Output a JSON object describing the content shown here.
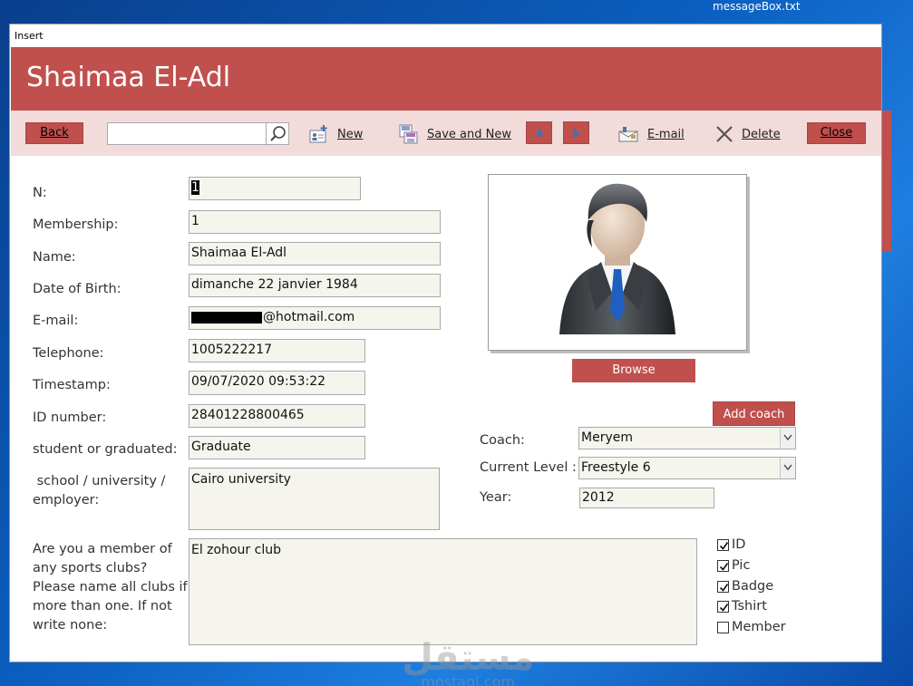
{
  "desktop": {
    "file_name": "messageBox.txt"
  },
  "window": {
    "title": "Insert"
  },
  "header": {
    "title": "Shaimaa El-Adl"
  },
  "toolbar": {
    "back_label": "Back",
    "search_value": "",
    "new_label": "New",
    "save_new_label": "Save and New",
    "email_label": "E-mail",
    "delete_label": "Delete",
    "close_label": "Close"
  },
  "form": {
    "n": {
      "label": "N:",
      "value": "1"
    },
    "membership": {
      "label": "Membership:",
      "value": "1"
    },
    "name": {
      "label": "Name:",
      "value": "Shaimaa El-Adl"
    },
    "dob": {
      "label": "Date of Birth:",
      "value": "dimanche 22 janvier 1984"
    },
    "email": {
      "label": "E-mail:",
      "value": "@hotmail.com"
    },
    "telephone": {
      "label": "Telephone:",
      "value": "1005222217"
    },
    "timestamp": {
      "label": "Timestamp:",
      "value": "09/07/2020 09:53:22"
    },
    "id_number": {
      "label": "ID number:",
      "value": "28401228800465"
    },
    "status": {
      "label": "student or graduated:",
      "value": "Graduate"
    },
    "school": {
      "label_line1": " school / university /",
      "label_line2": "employer:",
      "value": "Cairo university"
    },
    "clubs": {
      "label_line1": "Are you a member of",
      "label_line2": "any sports clubs?",
      "label_line3": "Please name all clubs if",
      "label_line4": "more than one. If not",
      "label_line5": "write none:",
      "value": "El zohour club"
    }
  },
  "right_panel": {
    "browse_label": "Browse",
    "add_coach_label": "Add coach",
    "coach": {
      "label": "Coach:",
      "value": "Meryem"
    },
    "level": {
      "label": "Current Level :",
      "value": "Freestyle 6"
    },
    "year": {
      "label": "Year:",
      "value": "2012"
    }
  },
  "checklist": [
    {
      "label": "ID",
      "checked": true
    },
    {
      "label": "Pic",
      "checked": true
    },
    {
      "label": "Badge",
      "checked": true
    },
    {
      "label": "Tshirt",
      "checked": true
    },
    {
      "label": "Member",
      "checked": false
    }
  ],
  "watermark": {
    "arabic": "مستقل",
    "latin": "mostaql.com"
  },
  "colors": {
    "accent": "#c0504d",
    "toolbar_bg": "#f2dcdb",
    "field_bg": "#f5f5ee"
  }
}
